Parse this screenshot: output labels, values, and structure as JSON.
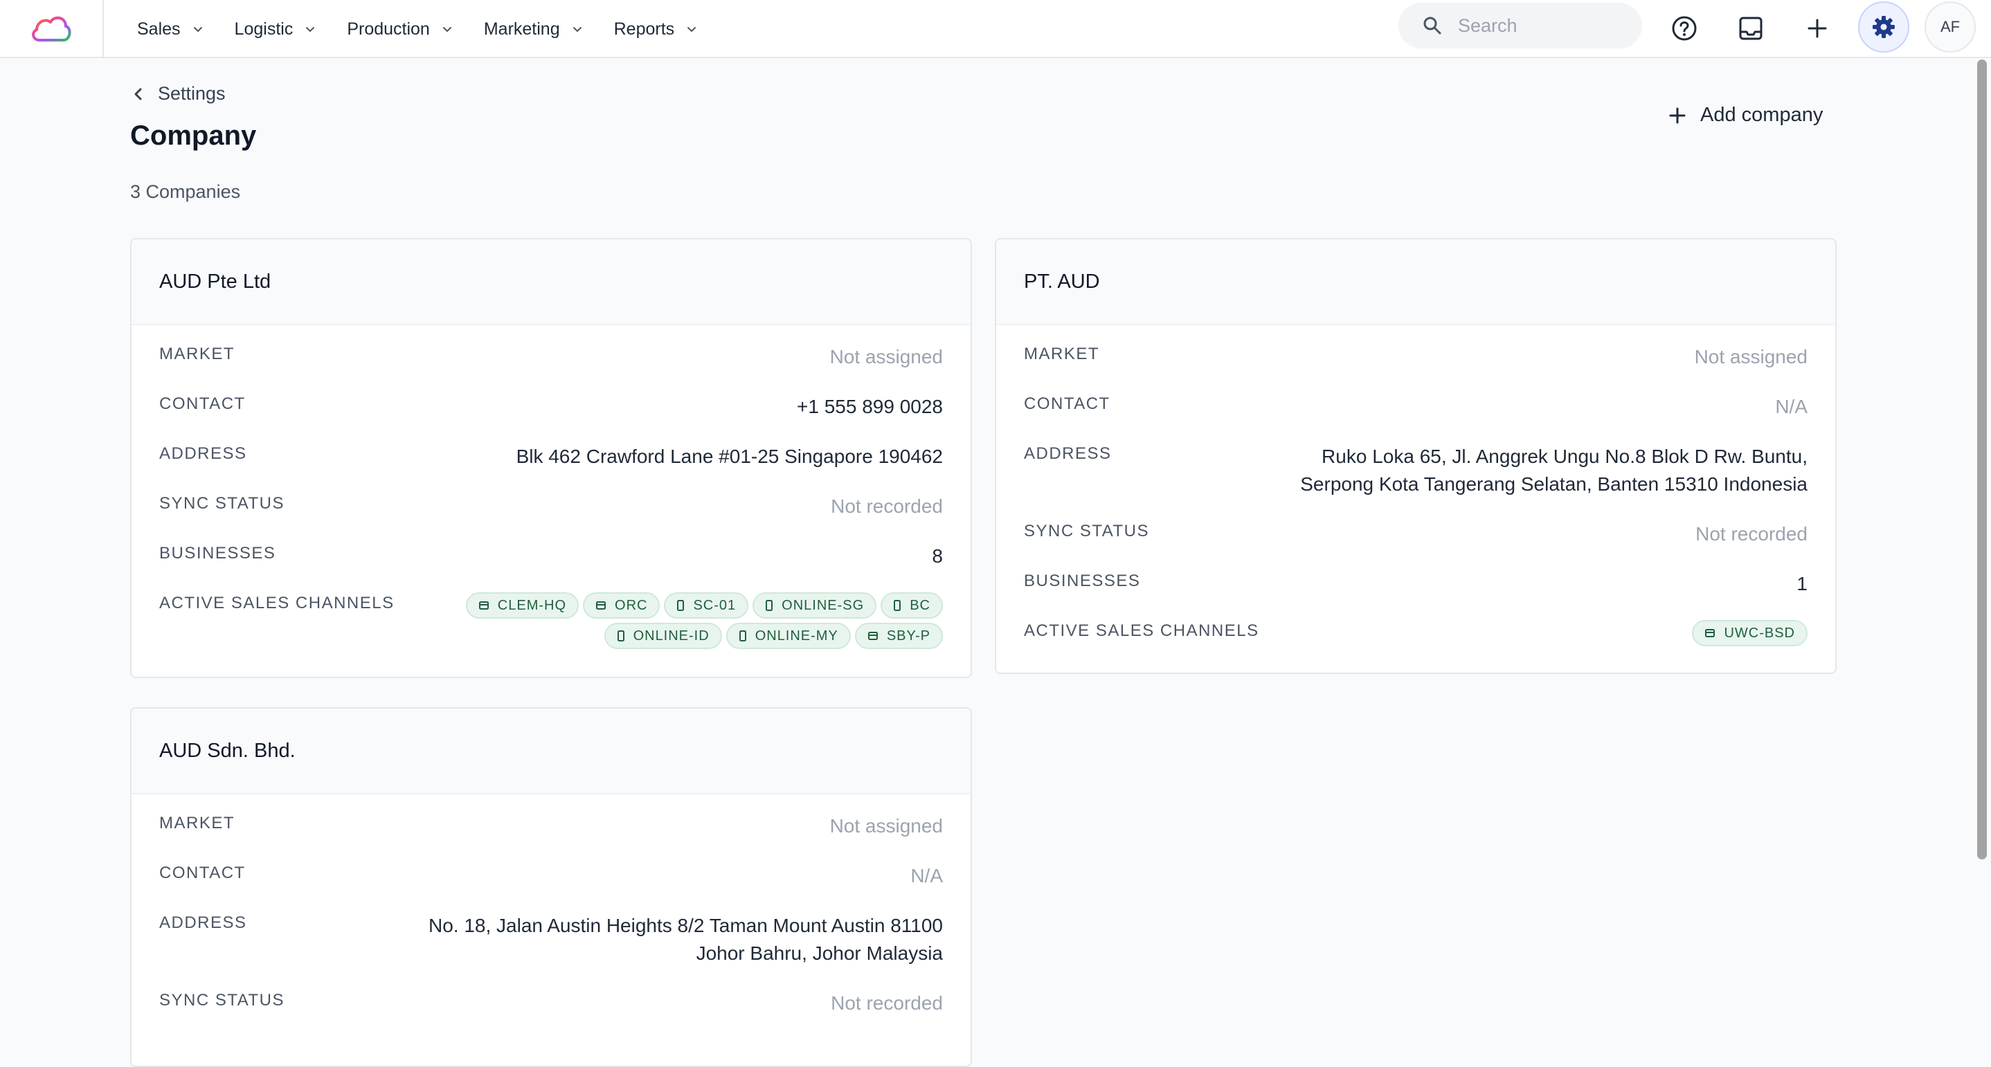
{
  "nav": {
    "items": [
      {
        "label": "Sales"
      },
      {
        "label": "Logistic"
      },
      {
        "label": "Production"
      },
      {
        "label": "Marketing"
      },
      {
        "label": "Reports"
      }
    ]
  },
  "search": {
    "placeholder": "Search"
  },
  "user": {
    "initials": "AF"
  },
  "header": {
    "back_label": "Settings",
    "title": "Company",
    "count_text": "3 Companies",
    "add_label": "Add company"
  },
  "labels": {
    "market": "MARKET",
    "contact": "CONTACT",
    "address": "ADDRESS",
    "sync_status": "SYNC STATUS",
    "businesses": "BUSINESSES",
    "active_sales_channels": "ACTIVE SALES CHANNELS"
  },
  "companies": [
    {
      "name": "AUD Pte Ltd",
      "market": "Not assigned",
      "contact": "+1 555 899 0028",
      "address_lines": [
        "Blk 462 Crawford Lane #01-25 Singapore 190462"
      ],
      "sync_status": "Not recorded",
      "businesses": "8",
      "channels": [
        {
          "label": "CLEM-HQ",
          "icon": "store-icon"
        },
        {
          "label": "ORC",
          "icon": "store-icon"
        },
        {
          "label": "SC-01",
          "icon": "phone-icon"
        },
        {
          "label": "ONLINE-SG",
          "icon": "phone-icon"
        },
        {
          "label": "BC",
          "icon": "phone-icon"
        },
        {
          "label": "ONLINE-ID",
          "icon": "phone-icon"
        },
        {
          "label": "ONLINE-MY",
          "icon": "phone-icon"
        },
        {
          "label": "SBY-P",
          "icon": "store-icon"
        }
      ]
    },
    {
      "name": "PT. AUD",
      "market": "Not assigned",
      "contact": "N/A",
      "address_lines": [
        "Ruko Loka 65, Jl. Anggrek Ungu No.8 Blok D Rw. Buntu,",
        "Serpong Kota Tangerang Selatan, Banten 15310 Indonesia"
      ],
      "sync_status": "Not recorded",
      "businesses": "1",
      "channels": [
        {
          "label": "UWC-BSD",
          "icon": "store-icon"
        }
      ]
    },
    {
      "name": "AUD Sdn. Bhd.",
      "market": "Not assigned",
      "contact": "N/A",
      "address_lines": [
        "No. 18, Jalan Austin Heights 8/2 Taman Mount Austin 81100",
        "Johor Bahru, Johor Malaysia"
      ],
      "sync_status": "Not recorded"
    }
  ],
  "colors": {
    "chip_bg": "#e8f5ee",
    "chip_text": "#1f5f3d",
    "muted_text": "#9ca3af",
    "accent": "#1e3a8a"
  }
}
